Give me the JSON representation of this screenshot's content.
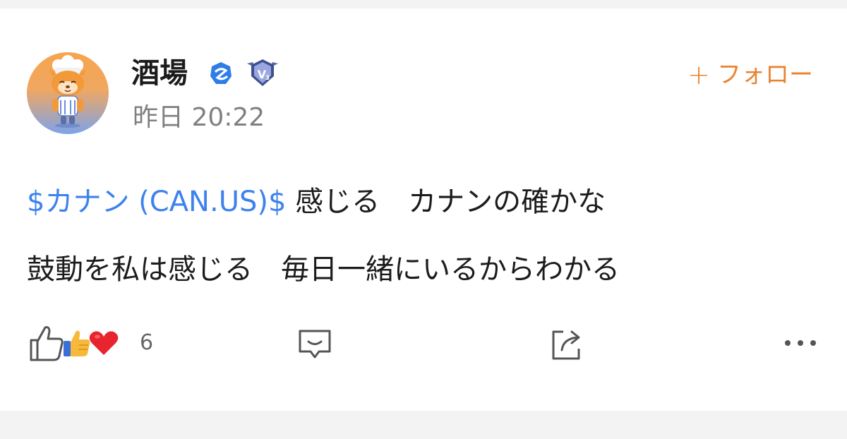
{
  "post": {
    "author": {
      "name": "酒場",
      "avatar": "chef-mascot-avatar",
      "verified_icon": "verified-badge-icon",
      "level_badge": "V3"
    },
    "timestamp": "昨日 20:22",
    "follow_label": "フォロー",
    "follow_prefix": "+",
    "body": {
      "ticker": "$カナン (CAN.US)$",
      "line1_rest": " 感じる　カナンの確かな",
      "line2": "鼓動を私は感じる　毎日一緒にいるからわかる"
    },
    "actions": {
      "reaction_count": "6",
      "like_icon": "thumbs-up-outline-icon",
      "reaction_icons": [
        "thumbs-up-emoji-icon",
        "heart-emoji-icon"
      ],
      "comment_icon": "comment-icon",
      "share_icon": "share-icon",
      "more_icon": "more-icon"
    }
  },
  "colors": {
    "accent_orange": "#e88432",
    "link_blue": "#3d82ee",
    "timestamp_gray": "#808080",
    "background": "#f3f3f4",
    "card": "#ffffff"
  }
}
